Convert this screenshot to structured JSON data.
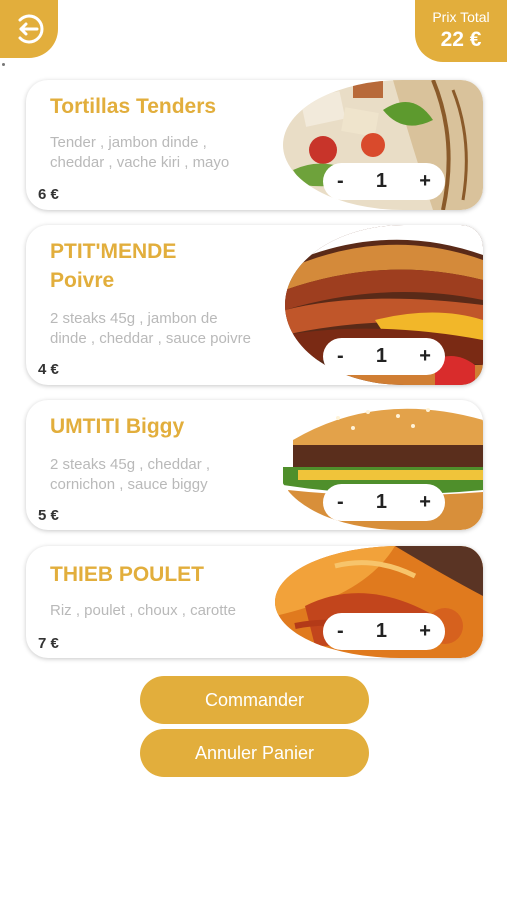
{
  "header": {
    "back_icon": "logout-arrow-icon",
    "total_label": "Prix Total",
    "total_value": "22 €"
  },
  "colors": {
    "accent": "#E2AE3C",
    "title": "#E2AE3C",
    "description": "#B9B9B9",
    "price": "#333333"
  },
  "cart": {
    "items": [
      {
        "name": "Tortillas Tenders",
        "description": "Tender , jambon dinde ,\ncheddar , vache kiri , mayo",
        "price": "6 €",
        "quantity": "1",
        "minus": "-",
        "plus": "+"
      },
      {
        "name": "PTIT'MENDE\nPoivre",
        "description": "2 steaks 45g , jambon de\ndinde , cheddar , sauce poivre",
        "price": "4 €",
        "quantity": "1",
        "minus": "-",
        "plus": "+"
      },
      {
        "name": "UMTITI Biggy",
        "description": "2 steaks 45g , cheddar ,\ncornichon , sauce biggy",
        "price": "5 €",
        "quantity": "1",
        "minus": "-",
        "plus": "+"
      },
      {
        "name": "THIEB POULET",
        "description": "Riz , poulet , choux , carotte",
        "price": "7 €",
        "quantity": "1",
        "minus": "-",
        "plus": "+"
      }
    ]
  },
  "actions": {
    "order_label": "Commander",
    "cancel_label": "Annuler Panier"
  }
}
